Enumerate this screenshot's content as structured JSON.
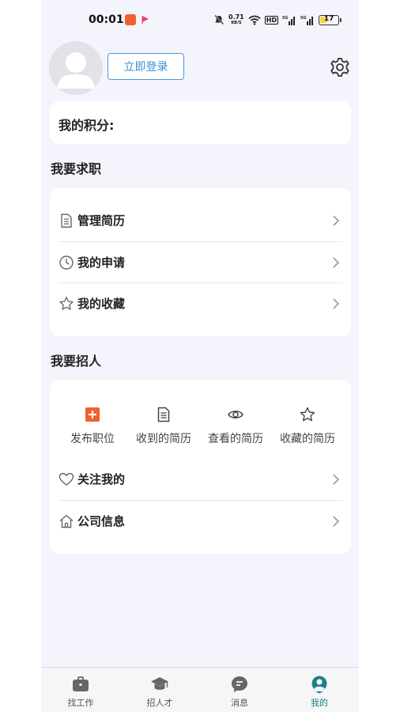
{
  "status_bar": {
    "time": "00:01",
    "net_speed_value": "0.71",
    "net_speed_unit": "KB/S",
    "hd_badge": "HD",
    "battery_level": "17"
  },
  "profile": {
    "login_button": "立即登录",
    "points_label": "我的积分:"
  },
  "job_seeking": {
    "title": "我要求职",
    "items": [
      {
        "label": "管理简历",
        "icon": "document-icon"
      },
      {
        "label": "我的申请",
        "icon": "clock-icon"
      },
      {
        "label": "我的收藏",
        "icon": "star-icon"
      }
    ]
  },
  "recruiting": {
    "title": "我要招人",
    "grid": [
      {
        "label": "发布职位",
        "icon": "plus-square-icon"
      },
      {
        "label": "收到的简历",
        "icon": "document-icon"
      },
      {
        "label": "查看的简历",
        "icon": "eye-icon"
      },
      {
        "label": "收藏的简历",
        "icon": "star-icon"
      }
    ],
    "items": [
      {
        "label": "关注我的",
        "icon": "heart-icon"
      },
      {
        "label": "公司信息",
        "icon": "home-icon"
      }
    ]
  },
  "tabbar": {
    "tabs": [
      {
        "label": "找工作",
        "icon": "briefcase-icon"
      },
      {
        "label": "招人才",
        "icon": "graduation-cap-icon"
      },
      {
        "label": "消息",
        "icon": "chat-icon"
      },
      {
        "label": "我的",
        "icon": "user-icon"
      }
    ],
    "active_index": 3
  },
  "colors": {
    "accent_blue": "#3a8ed0",
    "accent_orange": "#f0622d",
    "active_tab": "#1d7f86",
    "page_background": "#f4f4fd"
  }
}
